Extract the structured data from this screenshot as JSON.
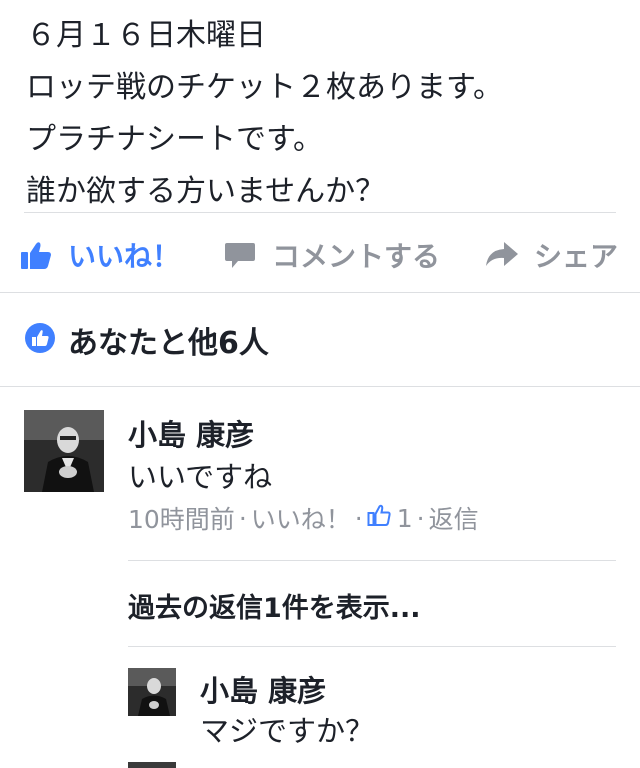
{
  "post": {
    "lines": [
      "６月１６日木曜日",
      "ロッテ戦のチケット２枚あります。",
      "プラチナシートです。",
      "誰か欲する方いませんか？"
    ]
  },
  "actions": {
    "like_label": "いいね！",
    "comment_label": "コメントする",
    "share_label": "シェア"
  },
  "reactions": {
    "text": "あなたと他6人"
  },
  "comments": [
    {
      "author": "小島 康彦",
      "text": "いいですね",
      "time": "10時間前",
      "like_label": "いいね！",
      "like_count": "1",
      "reply_label": "返信",
      "separator": "·"
    }
  ],
  "replies": {
    "show_previous": "過去の返信1件を表示...",
    "items": [
      {
        "author": "小島 康彦",
        "text": "マジですか？"
      }
    ]
  },
  "colors": {
    "accent": "#4080ff",
    "muted": "#90949c",
    "text": "#1d2129"
  }
}
